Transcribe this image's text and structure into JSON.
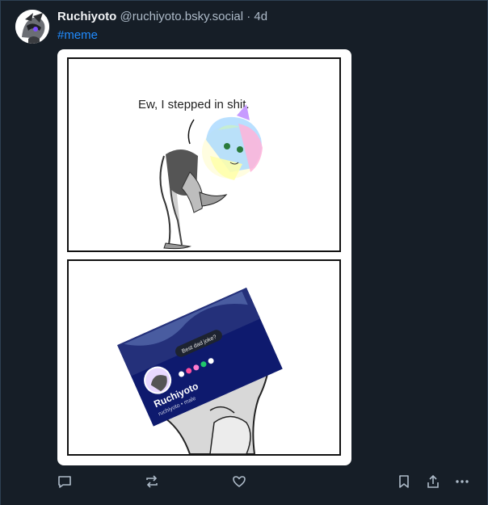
{
  "post": {
    "author_name": "Ruchiyoto",
    "handle": "@ruchiyoto.bsky.social",
    "separator": "·",
    "time": "4d",
    "hashtag": "#meme"
  },
  "media": {
    "panel1_caption": "Ew, I stepped in shit.",
    "card_status": "Best dad joke?",
    "card_name": "Ruchiyoto",
    "card_sub": "ruchiyoto • male"
  },
  "icons": {
    "reply": "reply-icon",
    "repost": "repost-icon",
    "like": "heart-icon",
    "bookmark": "bookmark-icon",
    "share": "share-icon",
    "more": "more-icon"
  },
  "colors": {
    "background": "#161e27",
    "link": "#208bfe",
    "muted": "#aebbc9"
  }
}
